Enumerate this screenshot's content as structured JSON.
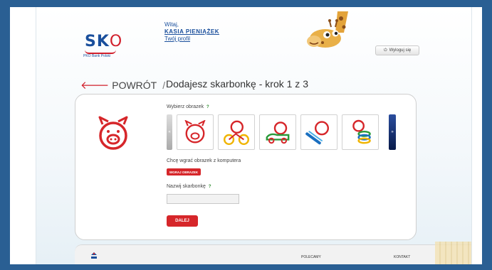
{
  "header": {
    "logo_main": "SK",
    "logo_o": "O",
    "logo_sub": "PKO Bank Polski",
    "greeting": "Witaj,",
    "user_name": "KASIA PIENIĄŻEK",
    "profile_link": "Twój profil",
    "logout_label": "Wyloguj się"
  },
  "title_row": {
    "back_label": "POWRÓT",
    "slash": "/",
    "page_title": "Dodajesz skarbonkę - krok 1 z 3"
  },
  "form": {
    "choose_image_label": "Wybierz obrazek",
    "upload_label": "Chcę wgrać obrazek z komputera",
    "upload_button": "WGRAJ OBRAZEK",
    "name_label": "Nazwij skarbonkę",
    "name_value": "",
    "next_button": "DALEJ",
    "help_icon_text": "?"
  },
  "thumbnails": [
    {
      "icon": "pig-icon"
    },
    {
      "icon": "pig-bike-icon"
    },
    {
      "icon": "pig-car-icon"
    },
    {
      "icon": "pig-skateboard-icon"
    },
    {
      "icon": "pig-stack-icon"
    }
  ],
  "footer": {
    "recommend_label": "POLECAMY",
    "contact_label": "KONTAKT"
  },
  "colors": {
    "accent_red": "#d6262a",
    "brand_blue": "#1a4f9c",
    "frame_blue": "#2a5f93"
  }
}
